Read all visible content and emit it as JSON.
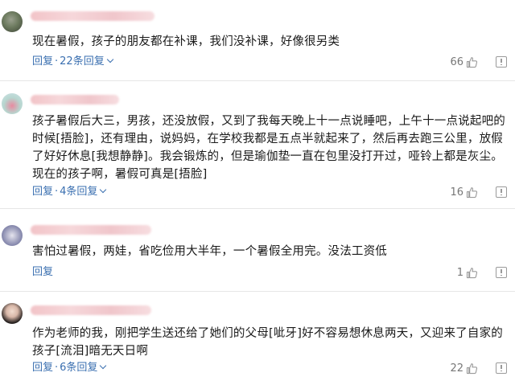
{
  "comments": [
    {
      "text": "现在暑假，孩子的朋友都在补课，我们没补课，好像很另类",
      "reply": "回复",
      "sep": "·",
      "replies": "22条回复",
      "likes": "66"
    },
    {
      "text": "孩子暑假后大三，男孩，还没放假，又到了我每天晚上十一点说睡吧，上午十一点说起吧的时候[捂脸]，还有理由，说妈妈，在学校我都是五点半就起来了，然后再去跑三公里，放假了好好休息[我想静静]。我会锻炼的，但是瑜伽垫一直在包里没打开过，哑铃上都是灰尘。现在的孩子啊，暑假可真是[捂脸]",
      "reply": "回复",
      "sep": "·",
      "replies": "4条回复",
      "likes": "16"
    },
    {
      "text": "害怕过暑假，两娃，省吃俭用大半年，一个暑假全用完。没法工资低",
      "reply": "回复",
      "likes": "1"
    },
    {
      "text": "作为老师的我，刚把学生送还给了她们的父母[呲牙]好不容易想休息两天，又迎来了自家的孩子[流泪]暗无天日啊",
      "reply": "回复",
      "sep": "·",
      "replies": "6条回复",
      "likes": "22"
    }
  ],
  "colors": {
    "link": "#3a6fb0",
    "divider": "#e6e6e6",
    "muted": "#777777"
  }
}
